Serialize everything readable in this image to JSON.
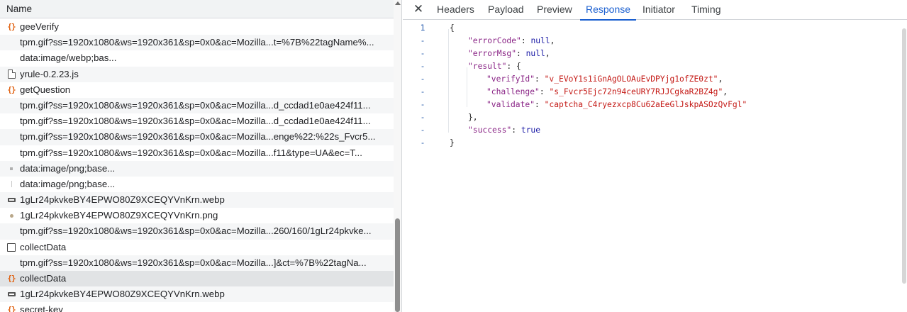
{
  "list": {
    "header": "Name",
    "rows": [
      {
        "icon": "json-icon",
        "label": "geeVerify"
      },
      {
        "icon": "none",
        "label": "tpm.gif?ss=1920x1080&ws=1920x361&sp=0x0&ac=Mozilla...t=%7B%22tagName%..."
      },
      {
        "icon": "none",
        "label": "data:image/webp;bas..."
      },
      {
        "icon": "document-icon",
        "label": "yrule-0.2.23.js"
      },
      {
        "icon": "json-icon",
        "label": "getQuestion"
      },
      {
        "icon": "none",
        "label": "tpm.gif?ss=1920x1080&ws=1920x361&sp=0x0&ac=Mozilla...d_ccdad1e0ae424f11..."
      },
      {
        "icon": "none",
        "label": "tpm.gif?ss=1920x1080&ws=1920x361&sp=0x0&ac=Mozilla...d_ccdad1e0ae424f11..."
      },
      {
        "icon": "none",
        "label": "tpm.gif?ss=1920x1080&ws=1920x361&sp=0x0&ac=Mozilla...enge%22:%22s_Fvcr5..."
      },
      {
        "icon": "none",
        "label": "tpm.gif?ss=1920x1080&ws=1920x361&sp=0x0&ac=Mozilla...f11&type=UA&ec=T..."
      },
      {
        "icon": "square-dot-icon",
        "label": "data:image/png;base..."
      },
      {
        "icon": "thin-line-icon",
        "label": "data:image/png;base..."
      },
      {
        "icon": "image-icon",
        "label": "1gLr24pkvkeBY4EPWO80Z9XCEQYVnKrn.webp"
      },
      {
        "icon": "dot-icon",
        "label": "1gLr24pkvkeBY4EPWO80Z9XCEQYVnKrn.png"
      },
      {
        "icon": "none",
        "label": "tpm.gif?ss=1920x1080&ws=1920x361&sp=0x0&ac=Mozilla...260/160/1gLr24pkvke..."
      },
      {
        "icon": "box-icon",
        "label": "collectData"
      },
      {
        "icon": "none",
        "label": "tpm.gif?ss=1920x1080&ws=1920x361&sp=0x0&ac=Mozilla...]&ct=%7B%22tagNa..."
      },
      {
        "icon": "json-icon",
        "label": "collectData",
        "selected": true
      },
      {
        "icon": "image-icon",
        "label": "1gLr24pkvkeBY4EPWO80Z9XCEQYVnKrn.webp"
      },
      {
        "icon": "json-icon",
        "label": "secret-key"
      }
    ]
  },
  "tabs": {
    "close": "✕",
    "items": [
      "Headers",
      "Payload",
      "Preview",
      "Response",
      "Initiator",
      "Timing"
    ],
    "active": "Response"
  },
  "response": {
    "line_number": "1",
    "fold_marker": "-",
    "lines": [
      [
        {
          "t": "p",
          "v": "{"
        }
      ],
      [
        {
          "t": "k",
          "v": "\"errorCode\""
        },
        {
          "t": "p",
          "v": ": "
        },
        {
          "t": "n",
          "v": "null"
        },
        {
          "t": "p",
          "v": ","
        }
      ],
      [
        {
          "t": "k",
          "v": "\"errorMsg\""
        },
        {
          "t": "p",
          "v": ": "
        },
        {
          "t": "n",
          "v": "null"
        },
        {
          "t": "p",
          "v": ","
        }
      ],
      [
        {
          "t": "k",
          "v": "\"result\""
        },
        {
          "t": "p",
          "v": ": {"
        }
      ],
      [
        {
          "t": "k",
          "v": "\"verifyId\""
        },
        {
          "t": "p",
          "v": ": "
        },
        {
          "t": "s",
          "v": "\"v_EVoY1s1iGnAgOLOAuEvDPYjg1ofZE0zt\""
        },
        {
          "t": "p",
          "v": ","
        }
      ],
      [
        {
          "t": "k",
          "v": "\"challenge\""
        },
        {
          "t": "p",
          "v": ": "
        },
        {
          "t": "s",
          "v": "\"s_Fvcr5Ejc72n94ceURY7RJJCgkaR2BZ4g\""
        },
        {
          "t": "p",
          "v": ","
        }
      ],
      [
        {
          "t": "k",
          "v": "\"validate\""
        },
        {
          "t": "p",
          "v": ": "
        },
        {
          "t": "s",
          "v": "\"captcha_C4ryezxcp8Cu62aEeGlJskpASOzQvFgl\""
        }
      ],
      [
        {
          "t": "p",
          "v": "},"
        }
      ],
      [
        {
          "t": "k",
          "v": "\"success\""
        },
        {
          "t": "p",
          "v": ": "
        },
        {
          "t": "n",
          "v": "true"
        }
      ],
      [
        {
          "t": "p",
          "v": "}"
        }
      ]
    ],
    "indent": [
      0,
      1,
      1,
      1,
      2,
      2,
      2,
      1,
      1,
      0
    ]
  },
  "colors": {
    "accent": "#1a5fd0",
    "json_key": "#8a2586",
    "json_string": "#c41a16",
    "json_literal": "#1a1aa6",
    "selected_row": "#e1e3e5"
  }
}
